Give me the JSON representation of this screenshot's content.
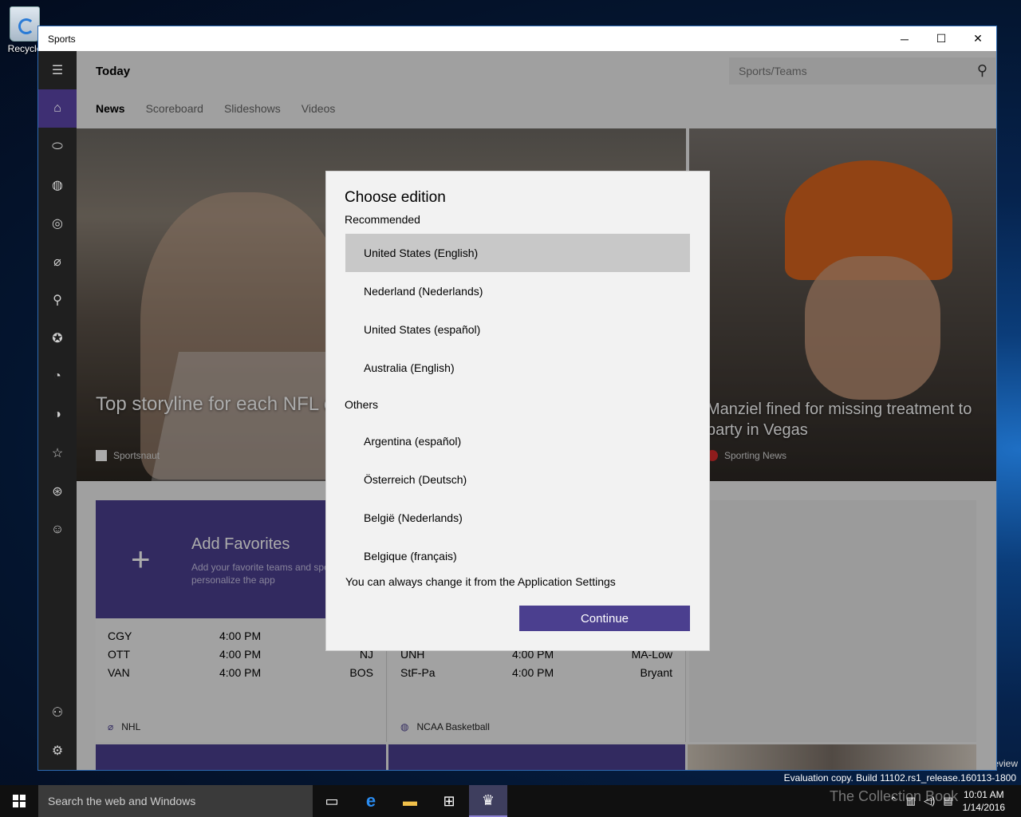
{
  "desktop": {
    "recycle_label": "Recycle",
    "watermark": "eview",
    "eval_text": "Evaluation copy. Build 11102.rs1_release.160113-1800"
  },
  "window": {
    "title": "Sports",
    "controls": {
      "minimize": "─",
      "maximize": "☐",
      "close": "✕"
    }
  },
  "header": {
    "title": "Today",
    "search_placeholder": "Sports/Teams",
    "tabs": [
      "News",
      "Scoreboard",
      "Slideshows",
      "Videos"
    ],
    "active_tab": "News"
  },
  "sidebar": {
    "items": [
      "home-icon",
      "football-icon",
      "basketball-icon",
      "baseball-icon",
      "hockey-icon",
      "golf-icon",
      "soccer-icon",
      "racing-icon",
      "tennis-icon",
      "favorites-icon",
      "rugby-icon",
      "smiley-icon"
    ],
    "bottom": [
      "add-user-icon",
      "settings-icon"
    ]
  },
  "hero": [
    {
      "title": "Top storyline for each NFL conference championship game",
      "source": "Sportsnaut"
    },
    {
      "title": "Manziel fined for missing treatment to party in Vegas",
      "source": "Sporting News"
    }
  ],
  "favorites": {
    "title": "Add Favorites",
    "subtitle": "Add your favorite teams and sports to personalize the app",
    "plus": "+"
  },
  "scores": [
    {
      "league": "NHL",
      "rows": [
        {
          "team": "CGY",
          "time": "4:00 PM",
          "opp": ""
        },
        {
          "team": "OTT",
          "time": "4:00 PM",
          "opp": "NJ"
        },
        {
          "team": "VAN",
          "time": "4:00 PM",
          "opp": "BOS"
        }
      ]
    },
    {
      "league": "NCAA Basketball",
      "rows": [
        {
          "team": "UNH",
          "time": "4:00 PM",
          "opp": "MA-Low"
        },
        {
          "team": "StF-Pa",
          "time": "4:00 PM",
          "opp": "Bryant"
        }
      ]
    }
  ],
  "dialog": {
    "title": "Choose edition",
    "recommended_label": "Recommended",
    "recommended": [
      "United States (English)",
      "Nederland (Nederlands)",
      "United States (español)",
      "Australia (English)"
    ],
    "selected": "United States (English)",
    "others_label": "Others",
    "others": [
      "Argentina (español)",
      "Österreich (Deutsch)",
      "België (Nederlands)",
      "Belgique (français)"
    ],
    "note": "You can always change it from the Application Settings",
    "continue_label": "Continue"
  },
  "taskbar": {
    "search_placeholder": "Search the web and Windows",
    "watermark": "The Collection Book",
    "time": "10:01 AM",
    "date": "1/14/2016"
  },
  "colors": {
    "accent": "#4b3f8f",
    "sidebar": "#1f1f1f",
    "selected_item": "#c8c8c8"
  }
}
